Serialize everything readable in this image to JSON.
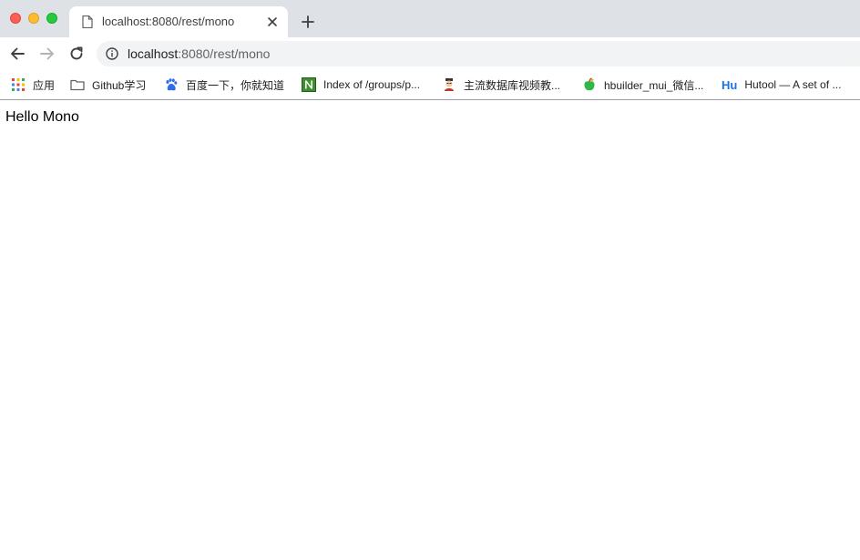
{
  "window": {
    "controls": [
      "close",
      "minimize",
      "maximize"
    ]
  },
  "tab": {
    "title": "localhost:8080/rest/mono",
    "icon": "page-icon"
  },
  "toolbar": {
    "back_icon": "arrow-left-icon",
    "forward_icon": "arrow-right-icon",
    "reload_icon": "reload-icon",
    "url_host": "localhost",
    "url_path": ":8080/rest/mono"
  },
  "bookmarks": [
    {
      "label": "应用",
      "icon": "apps-grid-icon"
    },
    {
      "label": "Github学习",
      "icon": "folder-icon"
    },
    {
      "label": "百度一下，你就知道",
      "icon": "baidu-paw-icon"
    },
    {
      "label": "Index of /groups/p...",
      "icon": "nexus-n-icon"
    },
    {
      "label": "主流数据库视频教...",
      "icon": "avatar-icon"
    },
    {
      "label": "hbuilder_mui_微信...",
      "icon": "apple-icon"
    },
    {
      "label": "Hutool — A set of ...",
      "icon": "hutool-icon",
      "badge": "Hu"
    }
  ],
  "page": {
    "body_text": "Hello Mono"
  },
  "colors": {
    "tabstrip": "#dee1e6",
    "omnibox": "#f1f3f4",
    "accent": "#1a73e8"
  }
}
